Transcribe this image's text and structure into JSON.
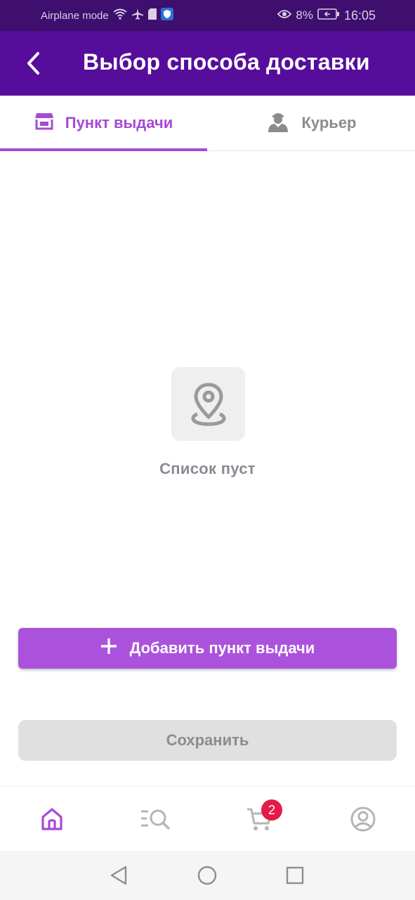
{
  "status_bar": {
    "mode_label": "Airplane mode",
    "battery_percent": "8%",
    "time": "16:05"
  },
  "header": {
    "title": "Выбор способа доставки"
  },
  "tabs": [
    {
      "label": "Пункт выдачи",
      "icon": "store-icon",
      "active": true
    },
    {
      "label": "Курьер",
      "icon": "courier-icon",
      "active": false
    }
  ],
  "empty_state": {
    "icon": "location-pin-icon",
    "message": "Список пуст"
  },
  "actions": {
    "add_label": "Добавить пункт выдачи",
    "save_label": "Сохранить"
  },
  "bottom_nav": {
    "items": [
      {
        "icon": "home-icon",
        "active": true
      },
      {
        "icon": "catalog-search-icon",
        "active": false
      },
      {
        "icon": "cart-icon",
        "active": false
      },
      {
        "icon": "profile-icon",
        "active": false
      }
    ],
    "cart_badge": "2"
  },
  "colors": {
    "status_bar": "#3e0f6e",
    "app_bar": "#560d9c",
    "accent": "#a64ad6",
    "button": "#ab52dd",
    "badge": "#e6194b"
  }
}
